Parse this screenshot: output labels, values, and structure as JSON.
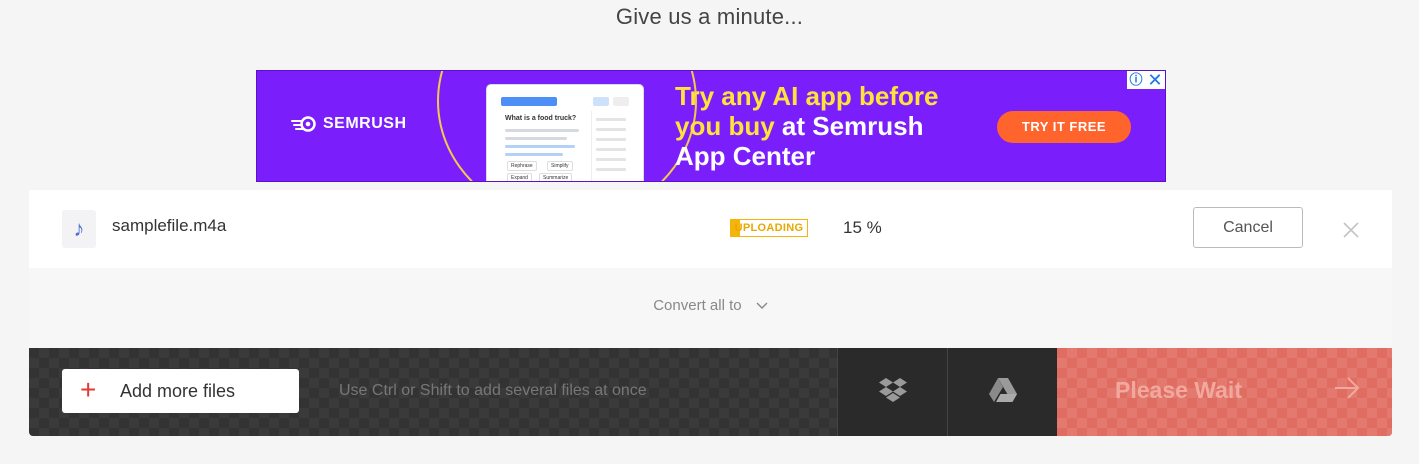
{
  "header": {
    "headline": "Give us a minute..."
  },
  "ad": {
    "brand": "SEMRUSH",
    "headline_highlight": "Try any AI app before you buy",
    "headline_rest": " at Semrush App Center",
    "cta": "TRY IT FREE",
    "mock": {
      "question": "What is a food truck?",
      "tags": [
        "Rephrase",
        "Simplify",
        "Expand",
        "Summarize"
      ]
    },
    "colors": {
      "background": "#7a1ffc",
      "highlight": "#ffe23b",
      "cta": "#ff642d"
    }
  },
  "file": {
    "name": "samplefile.m4a",
    "icon": "music-note-icon",
    "status": "UPLOADING",
    "progress_text": "15 %",
    "progress": 0.15,
    "cancel_label": "Cancel"
  },
  "convert": {
    "label": "Convert all to"
  },
  "bottom_bar": {
    "add_label": "Add more files",
    "hint": "Use Ctrl or Shift to add several files at once",
    "dropbox_icon": "dropbox-icon",
    "gdrive_icon": "google-drive-icon",
    "wait_label": "Please Wait",
    "colors": {
      "wait": "#e06d61",
      "add_plus": "#e53935"
    }
  }
}
